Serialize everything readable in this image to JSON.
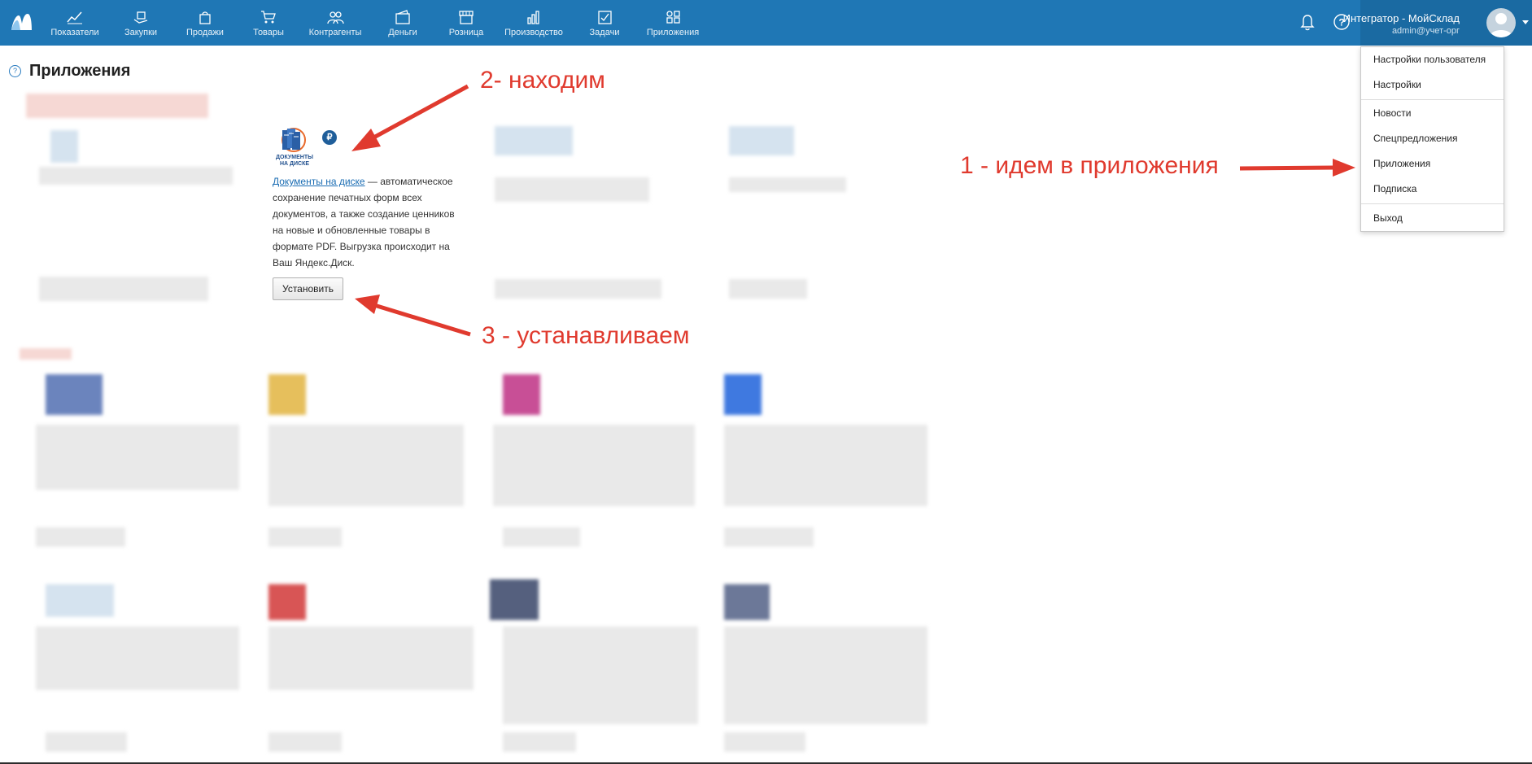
{
  "nav": {
    "items": [
      {
        "label": "Показатели",
        "icon": "chart-line-icon"
      },
      {
        "label": "Закупки",
        "icon": "basket-hand-icon"
      },
      {
        "label": "Продажи",
        "icon": "shopping-bag-icon"
      },
      {
        "label": "Товары",
        "icon": "cart-icon"
      },
      {
        "label": "Контрагенты",
        "icon": "people-icon"
      },
      {
        "label": "Деньги",
        "icon": "wallet-icon"
      },
      {
        "label": "Розница",
        "icon": "store-icon"
      },
      {
        "label": "Производство",
        "icon": "factory-icon"
      },
      {
        "label": "Задачи",
        "icon": "task-check-icon"
      },
      {
        "label": "Приложения",
        "icon": "apps-grid-icon"
      }
    ]
  },
  "user": {
    "name": "Интегратор - МойСклад",
    "email": "admin@учет-орг"
  },
  "menu": {
    "items": [
      "Настройки пользователя",
      "Настройки",
      "Новости",
      "Спецпредложения",
      "Приложения",
      "Подписка",
      "Выход"
    ]
  },
  "page": {
    "title": "Приложения",
    "help": "?"
  },
  "featured_app": {
    "logo_text": "ДОКУМЕНТЫ НА ДИСКЕ",
    "price_badge": "₽",
    "link": "Документы на диске",
    "description": " — автоматическое сохранение печатных форм всех документов, а также создание ценников на новые и обновленные товары в формате PDF. Выгрузка происходит на Ваш Яндекс.Диск.",
    "install_label": "Установить"
  },
  "annotations": {
    "step1": "1 - идем в приложения",
    "step2": "2- находим",
    "step3": "3 - устанавливаем"
  },
  "colors": {
    "topbar": "#1f77b5",
    "annotation": "#e03a2e",
    "link": "#1b6db3"
  }
}
